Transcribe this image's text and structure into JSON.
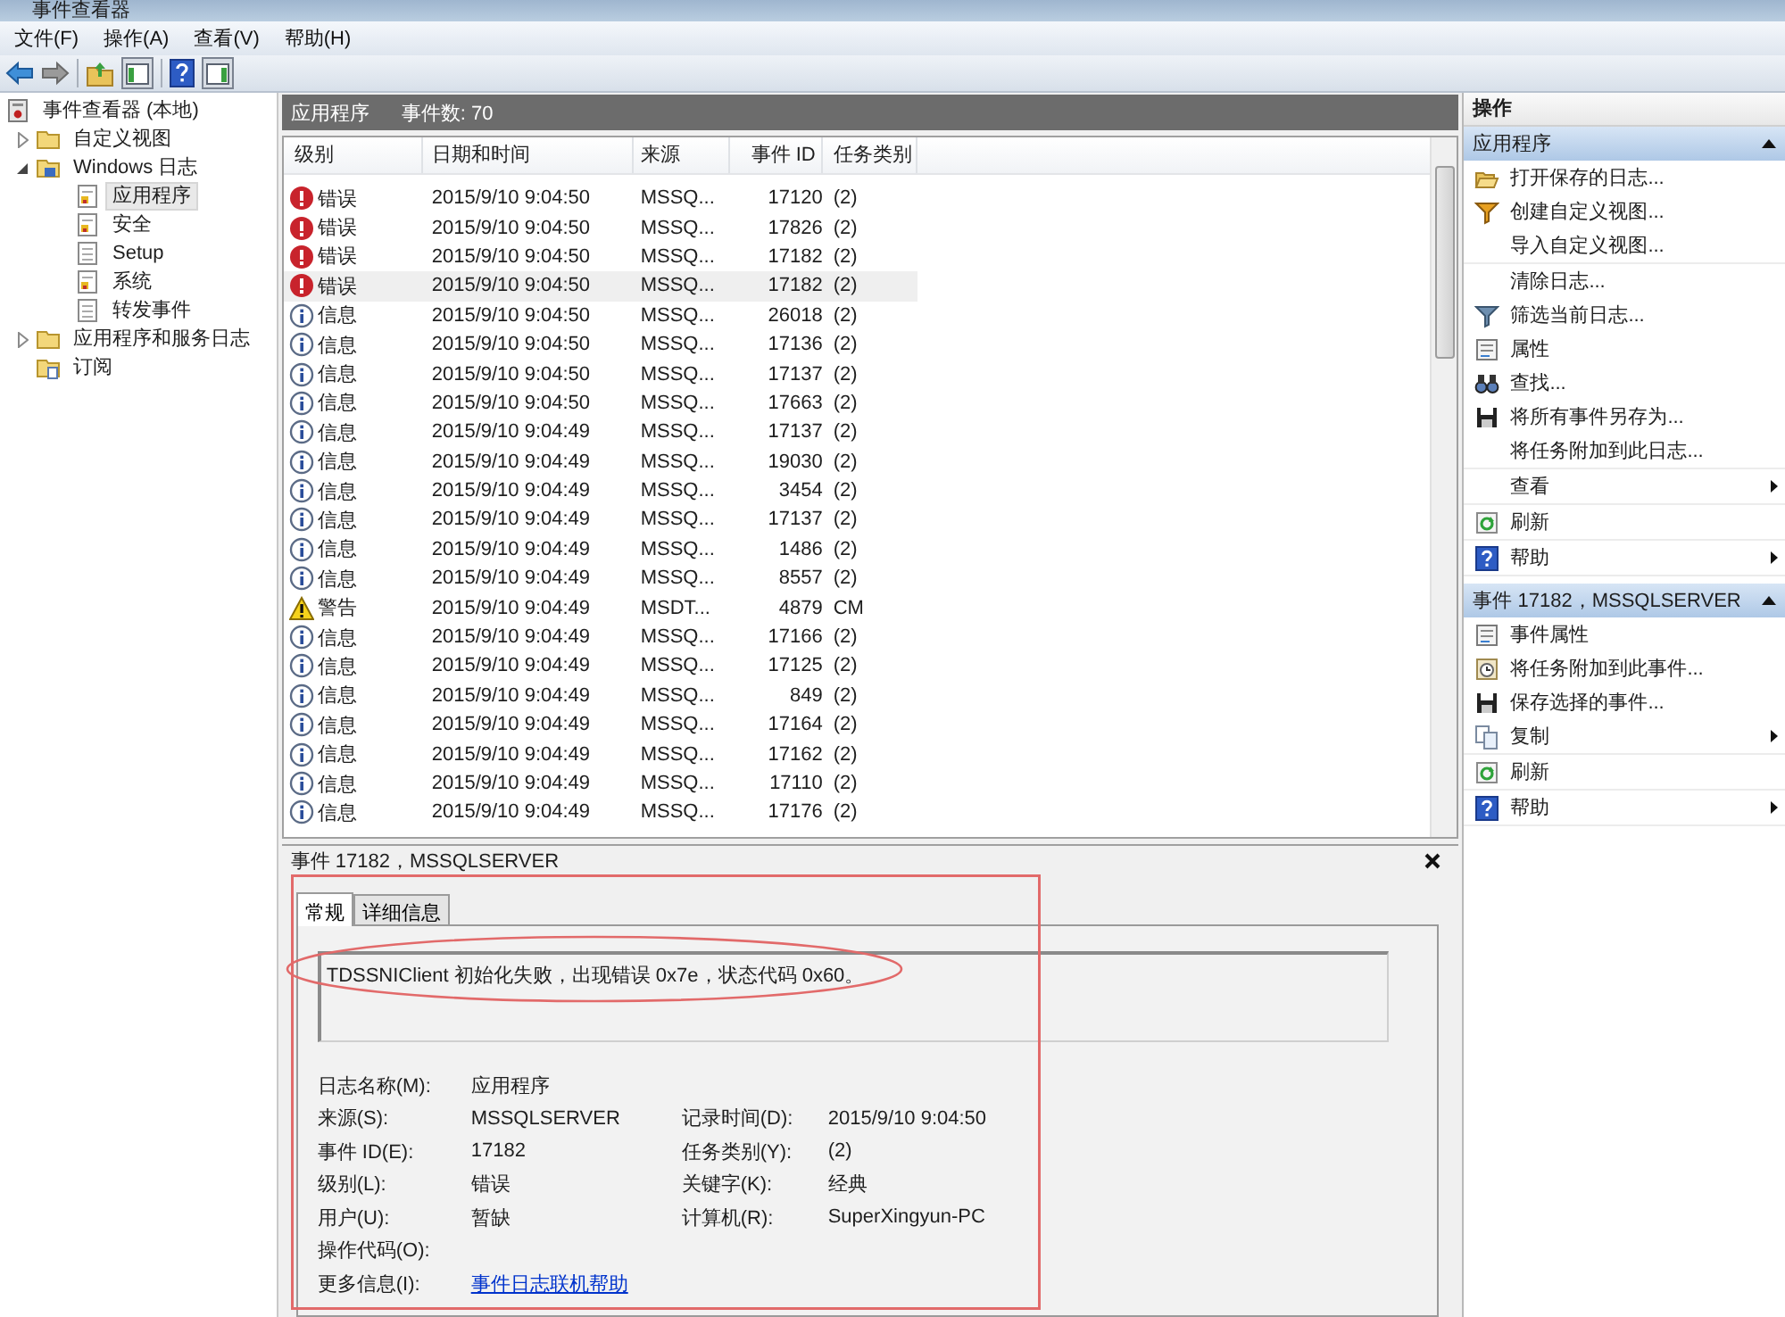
{
  "window": {
    "title": "事件查看器"
  },
  "menu": [
    {
      "label": "文件(F)"
    },
    {
      "label": "操作(A)"
    },
    {
      "label": "查看(V)"
    },
    {
      "label": "帮助(H)"
    }
  ],
  "tree": [
    {
      "label": "事件查看器 (本地)",
      "kind": "viewer",
      "selected": false,
      "children": [
        {
          "label": "自定义视图",
          "kind": "folder",
          "expanded": false,
          "selected": false
        },
        {
          "label": "Windows 日志",
          "kind": "winfolder",
          "expanded": true,
          "selected": false,
          "children": [
            {
              "label": "应用程序",
              "kind": "log",
              "selected": true
            },
            {
              "label": "安全",
              "kind": "log",
              "selected": false
            },
            {
              "label": "Setup",
              "kind": "plainlog",
              "selected": false
            },
            {
              "label": "系统",
              "kind": "log",
              "selected": false
            },
            {
              "label": "转发事件",
              "kind": "plainlog",
              "selected": false
            }
          ]
        },
        {
          "label": "应用程序和服务日志",
          "kind": "folder",
          "expanded": false,
          "selected": false
        },
        {
          "label": "订阅",
          "kind": "subscription",
          "selected": false
        }
      ]
    }
  ],
  "events": {
    "title": "应用程序",
    "count": "事件数: 70",
    "columns": [
      "级别",
      "日期和时间",
      "来源",
      "事件 ID",
      "任务类别"
    ],
    "rows": [
      {
        "kind": "error",
        "level": "错误",
        "date": "2015/9/10 9:04:50",
        "source": "MSSQ...",
        "id": "17120",
        "task": "(2)",
        "selected": false
      },
      {
        "kind": "error",
        "level": "错误",
        "date": "2015/9/10 9:04:50",
        "source": "MSSQ...",
        "id": "17826",
        "task": "(2)",
        "selected": false
      },
      {
        "kind": "error",
        "level": "错误",
        "date": "2015/9/10 9:04:50",
        "source": "MSSQ...",
        "id": "17182",
        "task": "(2)",
        "selected": false
      },
      {
        "kind": "error",
        "level": "错误",
        "date": "2015/9/10 9:04:50",
        "source": "MSSQ...",
        "id": "17182",
        "task": "(2)",
        "selected": true
      },
      {
        "kind": "info",
        "level": "信息",
        "date": "2015/9/10 9:04:50",
        "source": "MSSQ...",
        "id": "26018",
        "task": "(2)",
        "selected": false
      },
      {
        "kind": "info",
        "level": "信息",
        "date": "2015/9/10 9:04:50",
        "source": "MSSQ...",
        "id": "17136",
        "task": "(2)",
        "selected": false
      },
      {
        "kind": "info",
        "level": "信息",
        "date": "2015/9/10 9:04:50",
        "source": "MSSQ...",
        "id": "17137",
        "task": "(2)",
        "selected": false
      },
      {
        "kind": "info",
        "level": "信息",
        "date": "2015/9/10 9:04:50",
        "source": "MSSQ...",
        "id": "17663",
        "task": "(2)",
        "selected": false
      },
      {
        "kind": "info",
        "level": "信息",
        "date": "2015/9/10 9:04:49",
        "source": "MSSQ...",
        "id": "17137",
        "task": "(2)",
        "selected": false
      },
      {
        "kind": "info",
        "level": "信息",
        "date": "2015/9/10 9:04:49",
        "source": "MSSQ...",
        "id": "19030",
        "task": "(2)",
        "selected": false
      },
      {
        "kind": "info",
        "level": "信息",
        "date": "2015/9/10 9:04:49",
        "source": "MSSQ...",
        "id": "3454",
        "task": "(2)",
        "selected": false
      },
      {
        "kind": "info",
        "level": "信息",
        "date": "2015/9/10 9:04:49",
        "source": "MSSQ...",
        "id": "17137",
        "task": "(2)",
        "selected": false
      },
      {
        "kind": "info",
        "level": "信息",
        "date": "2015/9/10 9:04:49",
        "source": "MSSQ...",
        "id": "1486",
        "task": "(2)",
        "selected": false
      },
      {
        "kind": "info",
        "level": "信息",
        "date": "2015/9/10 9:04:49",
        "source": "MSSQ...",
        "id": "8557",
        "task": "(2)",
        "selected": false
      },
      {
        "kind": "warning",
        "level": "警告",
        "date": "2015/9/10 9:04:49",
        "source": "MSDT...",
        "id": "4879",
        "task": "CM",
        "selected": false
      },
      {
        "kind": "info",
        "level": "信息",
        "date": "2015/9/10 9:04:49",
        "source": "MSSQ...",
        "id": "17166",
        "task": "(2)",
        "selected": false
      },
      {
        "kind": "info",
        "level": "信息",
        "date": "2015/9/10 9:04:49",
        "source": "MSSQ...",
        "id": "17125",
        "task": "(2)",
        "selected": false
      },
      {
        "kind": "info",
        "level": "信息",
        "date": "2015/9/10 9:04:49",
        "source": "MSSQ...",
        "id": "849",
        "task": "(2)",
        "selected": false
      },
      {
        "kind": "info",
        "level": "信息",
        "date": "2015/9/10 9:04:49",
        "source": "MSSQ...",
        "id": "17164",
        "task": "(2)",
        "selected": false
      },
      {
        "kind": "info",
        "level": "信息",
        "date": "2015/9/10 9:04:49",
        "source": "MSSQ...",
        "id": "17162",
        "task": "(2)",
        "selected": false
      },
      {
        "kind": "info",
        "level": "信息",
        "date": "2015/9/10 9:04:49",
        "source": "MSSQ...",
        "id": "17110",
        "task": "(2)",
        "selected": false
      },
      {
        "kind": "info",
        "level": "信息",
        "date": "2015/9/10 9:04:49",
        "source": "MSSQ...",
        "id": "17176",
        "task": "(2)",
        "selected": false
      }
    ]
  },
  "detail": {
    "title": "事件 17182，MSSQLSERVER",
    "tabs": [
      {
        "label": "常规",
        "selected": true
      },
      {
        "label": "详细信息",
        "selected": false
      }
    ],
    "message": "TDSSNIClient 初始化失败，出现错误 0x7e，状态代码 0x60。",
    "rows": [
      {
        "left": {
          "label": "日志名称(M):",
          "value": "应用程序"
        }
      },
      {
        "left": {
          "label": "来源(S):",
          "value": "MSSQLSERVER"
        },
        "right": {
          "label": "记录时间(D):",
          "value": "2015/9/10 9:04:50"
        }
      },
      {
        "left": {
          "label": "事件 ID(E):",
          "value": "17182"
        },
        "right": {
          "label": "任务类别(Y):",
          "value": "(2)"
        }
      },
      {
        "left": {
          "label": "级别(L):",
          "value": "错误"
        },
        "right": {
          "label": "关键字(K):",
          "value": "经典"
        }
      },
      {
        "left": {
          "label": "用户(U):",
          "value": "暂缺"
        },
        "right": {
          "label": "计算机(R):",
          "value": "SuperXingyun-PC"
        }
      },
      {
        "left": {
          "label": "操作代码(O):"
        }
      },
      {
        "left": {
          "label": "更多信息(I):",
          "value": "事件日志联机帮助",
          "kind": "link"
        }
      }
    ]
  },
  "actions": {
    "title": "操作",
    "sections": [
      {
        "title": "应用程序",
        "expanded": true,
        "groups": [
          [
            {
              "label": "打开保存的日志...",
              "kind": "open",
              "submenu": false
            },
            {
              "label": "创建自定义视图...",
              "kind": "filter-create",
              "submenu": false
            },
            {
              "label": "导入自定义视图...",
              "kind": "plain",
              "submenu": false
            }
          ],
          [
            {
              "label": "清除日志...",
              "kind": "plain",
              "submenu": false
            },
            {
              "label": "筛选当前日志...",
              "kind": "filter",
              "submenu": false
            },
            {
              "label": "属性",
              "kind": "properties",
              "submenu": false
            },
            {
              "label": "查找...",
              "kind": "find",
              "submenu": false
            },
            {
              "label": "将所有事件另存为...",
              "kind": "save",
              "submenu": false
            },
            {
              "label": "将任务附加到此日志...",
              "kind": "plain",
              "submenu": false
            }
          ],
          [
            {
              "label": "查看",
              "kind": "plain",
              "submenu": true
            }
          ],
          [
            {
              "label": "刷新",
              "kind": "refresh",
              "submenu": false
            }
          ],
          [
            {
              "label": "帮助",
              "kind": "help",
              "submenu": true
            }
          ]
        ]
      },
      {
        "title": "事件 17182，MSSQLSERVER",
        "expanded": true,
        "groups": [
          [
            {
              "label": "事件属性",
              "kind": "properties",
              "submenu": false
            },
            {
              "label": "将任务附加到此事件...",
              "kind": "task",
              "submenu": false
            },
            {
              "label": "保存选择的事件...",
              "kind": "save",
              "submenu": false
            },
            {
              "label": "复制",
              "kind": "copy",
              "submenu": true
            }
          ],
          [
            {
              "label": "刷新",
              "kind": "refresh",
              "submenu": false
            }
          ],
          [
            {
              "label": "帮助",
              "kind": "help",
              "submenu": true
            }
          ]
        ]
      }
    ]
  }
}
